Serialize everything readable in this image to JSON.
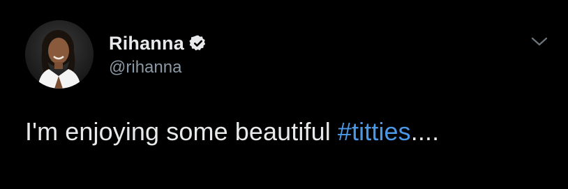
{
  "author": {
    "display_name": "Rihanna",
    "handle": "@rihanna",
    "verified": true,
    "avatar_icon": "profile-photo-woman-white-outfit"
  },
  "tweet": {
    "text_before": "I'm enjoying some beautiful ",
    "hashtag": "#titties",
    "text_after": "...."
  },
  "colors": {
    "background": "#000000",
    "text": "#e7e9ea",
    "secondary_text": "#8b98a5",
    "hashtag": "#4a99e9"
  },
  "icons": {
    "verified": "verified-badge-icon",
    "menu": "chevron-down-icon"
  }
}
